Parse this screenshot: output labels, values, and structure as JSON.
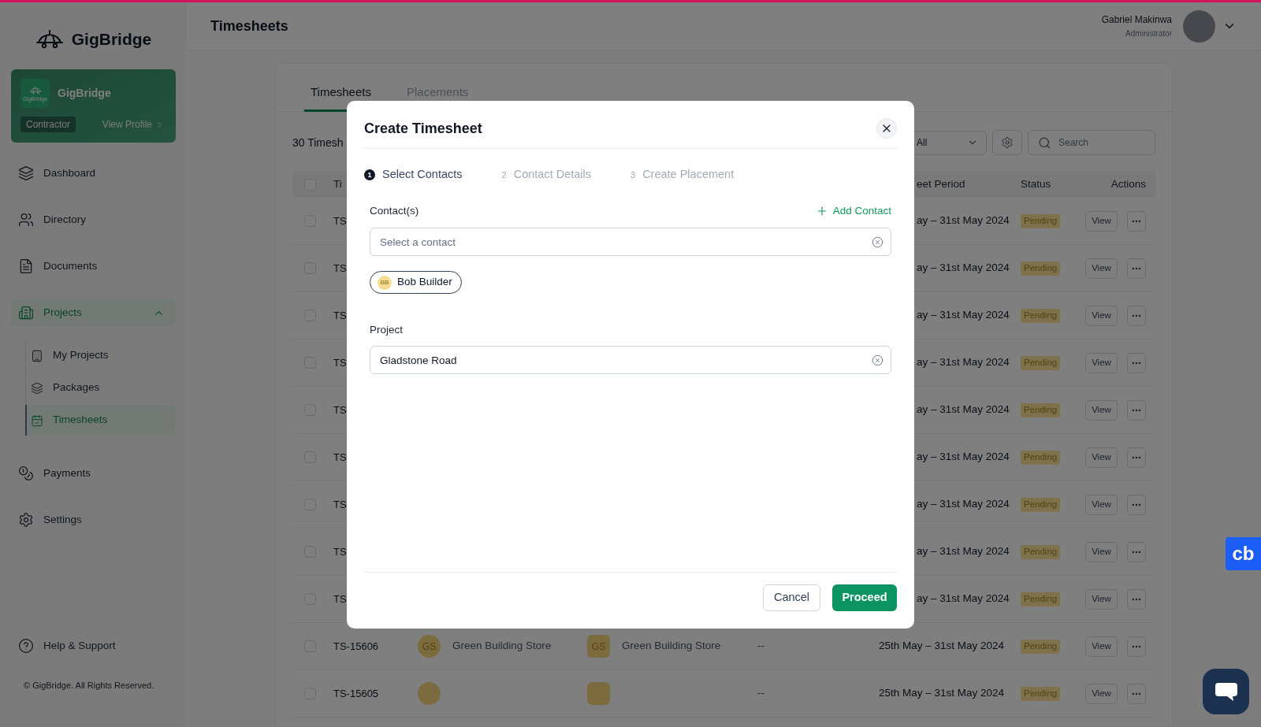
{
  "sidebar": {
    "logo": "GigBridge",
    "profile": {
      "tile_text": "GigBridge",
      "name": "GigBridge",
      "role": "Contractor",
      "link": "View Profile"
    },
    "nav": [
      {
        "label": "Dashboard",
        "selected": false
      },
      {
        "label": "Directory",
        "selected": false
      },
      {
        "label": "Documents",
        "selected": false
      },
      {
        "label": "Projects",
        "selected": true,
        "expanded": true,
        "children": [
          {
            "label": "My Projects",
            "selected": false
          },
          {
            "label": "Packages",
            "selected": false
          },
          {
            "label": "Timesheets",
            "selected": true
          }
        ]
      },
      {
        "label": "Payments",
        "selected": false
      },
      {
        "label": "Settings",
        "selected": false
      }
    ],
    "help": "Help & Support",
    "copyright": "© GigBridge. All Rights Reserved."
  },
  "header": {
    "title": "Timesheets",
    "user": {
      "name": "Gabriel Makinwa",
      "role": "Administrator"
    }
  },
  "content": {
    "tabs": [
      {
        "label": "Timesheets",
        "selected": true
      },
      {
        "label": "Placements",
        "selected": false
      }
    ],
    "count": "30 Timesh",
    "filter": {
      "value": "All"
    },
    "search": {
      "placeholder": "Search"
    },
    "table": {
      "header_checked": false,
      "columns": [
        "Ti",
        "eet Period",
        "Status",
        "Actions"
      ],
      "rows": [
        {
          "kind": "behind_modal",
          "checked": false,
          "id": "TS",
          "period": "ay – 31st May 2024",
          "status": "Pending",
          "action": "View"
        },
        {
          "kind": "behind_modal",
          "checked": false,
          "id": "TS",
          "period": "ay – 31st May 2024",
          "status": "Pending",
          "action": "View"
        },
        {
          "kind": "behind_modal",
          "checked": false,
          "id": "TS",
          "period": "ay – 31st May 2024",
          "status": "Pending",
          "action": "View"
        },
        {
          "kind": "behind_modal",
          "checked": false,
          "id": "TS",
          "period": "ay – 31st May 2024",
          "status": "Pending",
          "action": "View"
        },
        {
          "kind": "behind_modal",
          "checked": false,
          "id": "TS",
          "period": "ay – 31st May 2024",
          "status": "Pending",
          "action": "View"
        },
        {
          "kind": "behind_modal",
          "checked": false,
          "id": "TS",
          "period": "ay – 31st May 2024",
          "status": "Pending",
          "action": "View"
        },
        {
          "kind": "behind_modal",
          "checked": false,
          "id": "TS",
          "period": "ay – 31st May 2024",
          "status": "Pending",
          "action": "View"
        },
        {
          "kind": "behind_modal",
          "checked": false,
          "id": "TS",
          "period": "ay – 31st May 2024",
          "status": "Pending",
          "action": "View"
        },
        {
          "kind": "behind_modal",
          "checked": false,
          "id": "TS",
          "period": "ay – 31st May 2024",
          "status": "Pending",
          "action": "View"
        },
        {
          "kind": "full",
          "checked": false,
          "id": "TS-15606",
          "column_3": {
            "kind": "avatar_name",
            "initials": "GS",
            "name": "Green Building Store"
          },
          "column_4": {
            "kind": "avatar_name",
            "initials": "GS",
            "name": "Green Building Store"
          },
          "column_5": "--",
          "period": "25th May – 31st May 2024",
          "status": "Pending",
          "action": "View"
        },
        {
          "kind": "full",
          "checked": false,
          "id": "TS-15605",
          "column_3": {
            "kind": "blank_avatar"
          },
          "column_4": {
            "kind": "blank_avatar"
          },
          "column_5": "--",
          "period": "25th May – 31st May 2024",
          "status": "Pending",
          "action": "View"
        }
      ]
    }
  },
  "modal": {
    "title": "Create Timesheet",
    "steps": [
      {
        "number": "1",
        "label": "Select Contacts",
        "selected": true
      },
      {
        "number": "2",
        "label": "Contact Details",
        "selected": false
      },
      {
        "number": "3",
        "label": "Create Placement",
        "selected": false
      }
    ],
    "contacts": {
      "label": "Contact(s)",
      "add_link": "Add Contact",
      "placeholder": "Select a contact",
      "chips": [
        {
          "initials": "BB",
          "name": "Bob Builder"
        }
      ]
    },
    "project": {
      "label": "Project",
      "value": "Gladstone Road"
    },
    "buttons": [
      {
        "label": "Cancel",
        "kind": "secondary"
      },
      {
        "label": "Proceed",
        "kind": "primary"
      }
    ]
  },
  "widgets": {
    "side_badge": "cb"
  }
}
